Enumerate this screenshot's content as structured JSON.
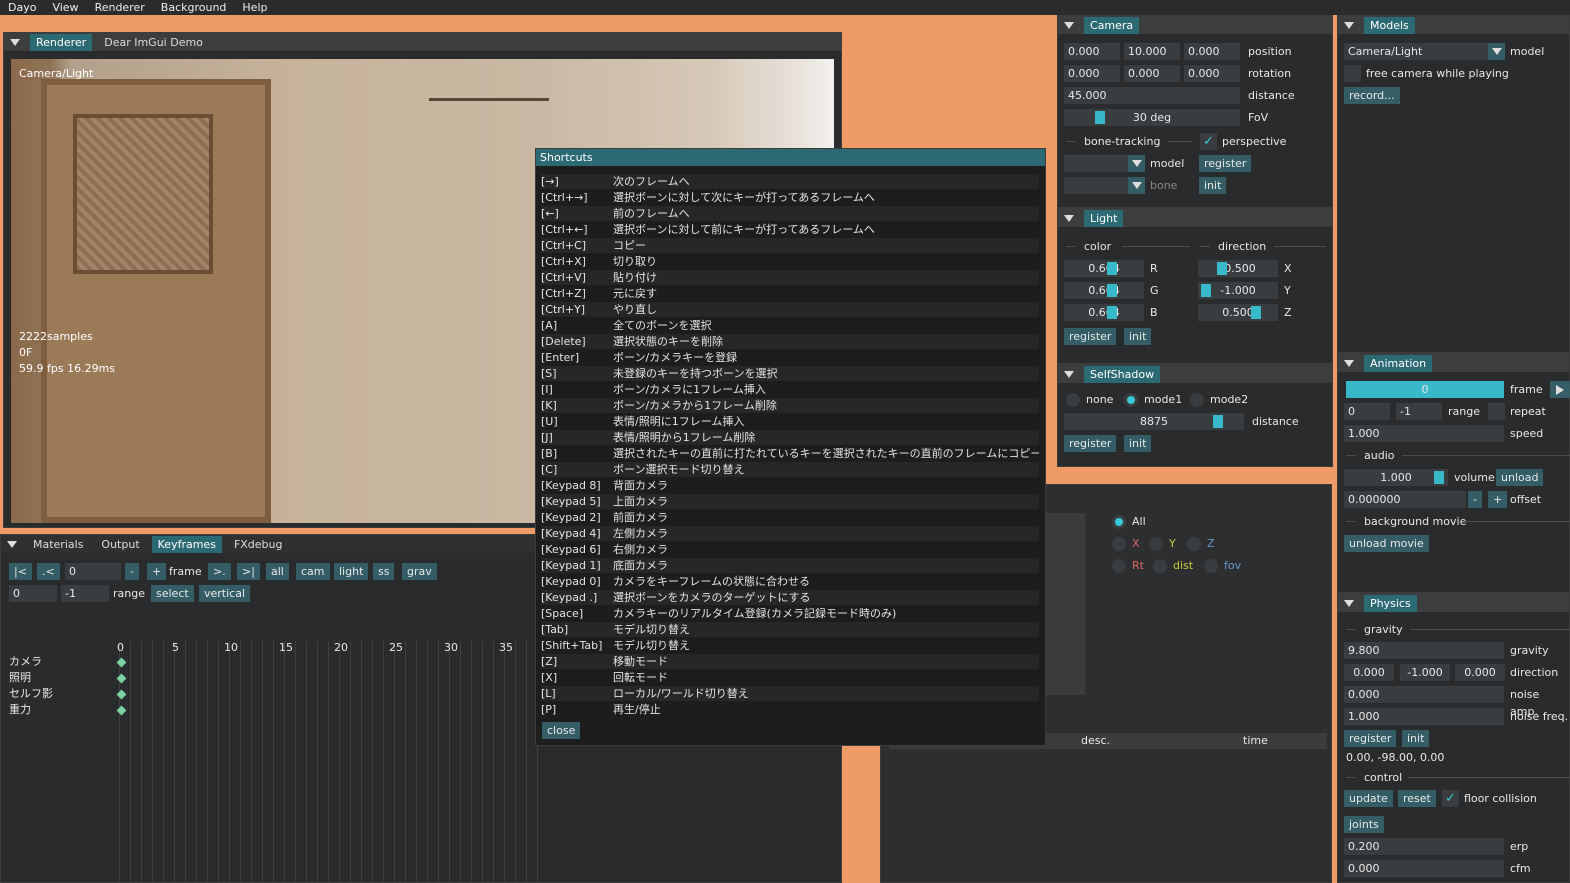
{
  "menu": [
    "Dayo",
    "View",
    "Renderer",
    "Background",
    "Help"
  ],
  "renderer_window": {
    "tabs": [
      "Renderer",
      "Dear ImGui Demo"
    ],
    "viewport_label": "Camera/Light",
    "stats": [
      "2222samples",
      "0F",
      "59.9 fps 16.29ms"
    ]
  },
  "bottom_window": {
    "tabs": [
      "Materials",
      "Output",
      "Keyframes",
      "FXdebug"
    ],
    "toolbar": {
      "first": "|<",
      "prev": ".<",
      "frame_value": "0",
      "minus": "-",
      "plus": "+",
      "frame_label": "frame",
      "next": ">.",
      "last": ">|",
      "all": "all",
      "cam": "cam",
      "light": "light",
      "ss": "ss",
      "grav": "grav"
    },
    "range": {
      "start": "0",
      "end": "-1",
      "label": "range",
      "select": "select",
      "vertical": "vertical"
    },
    "ticks": [
      "0",
      "5",
      "10",
      "15",
      "20",
      "25",
      "30",
      "35"
    ],
    "tracks": [
      "カメラ",
      "照明",
      "セルフ影",
      "重力"
    ]
  },
  "shortcuts": {
    "title": "Shortcuts",
    "rows": [
      {
        "key": "[→]",
        "desc": "次のフレームへ"
      },
      {
        "key": "[Ctrl+→]",
        "desc": "選択ボーンに対して次にキーが打ってあるフレームへ"
      },
      {
        "key": "[←]",
        "desc": "前のフレームへ"
      },
      {
        "key": "[Ctrl+←]",
        "desc": "選択ボーンに対して前にキーが打ってあるフレームへ"
      },
      {
        "key": "[Ctrl+C]",
        "desc": "コピー"
      },
      {
        "key": "[Ctrl+X]",
        "desc": "切り取り"
      },
      {
        "key": "[Ctrl+V]",
        "desc": "貼り付け"
      },
      {
        "key": "[Ctrl+Z]",
        "desc": "元に戻す"
      },
      {
        "key": "[Ctrl+Y]",
        "desc": "やり直し"
      },
      {
        "key": "[A]",
        "desc": "全てのボーンを選択"
      },
      {
        "key": "[Delete]",
        "desc": "選択状態のキーを削除"
      },
      {
        "key": "[Enter]",
        "desc": "ボーン/カメラキーを登録"
      },
      {
        "key": "[S]",
        "desc": "未登録のキーを持つボーンを選択"
      },
      {
        "key": "[I]",
        "desc": "ボーン/カメラに1フレーム挿入"
      },
      {
        "key": "[K]",
        "desc": "ボーン/カメラから1フレーム削除"
      },
      {
        "key": "[U]",
        "desc": "表情/照明に1フレーム挿入"
      },
      {
        "key": "[J]",
        "desc": "表情/照明から1フレーム削除"
      },
      {
        "key": "[B]",
        "desc": "選択されたキーの直前に打たれているキーを選択されたキーの直前のフレームにコピー"
      },
      {
        "key": "[C]",
        "desc": "ボーン選択モード切り替え"
      },
      {
        "key": "[Keypad 8]",
        "desc": "背面カメラ"
      },
      {
        "key": "[Keypad 5]",
        "desc": "上面カメラ"
      },
      {
        "key": "[Keypad 2]",
        "desc": "前面カメラ"
      },
      {
        "key": "[Keypad 4]",
        "desc": "左側カメラ"
      },
      {
        "key": "[Keypad 6]",
        "desc": "右側カメラ"
      },
      {
        "key": "[Keypad 1]",
        "desc": "底面カメラ"
      },
      {
        "key": "[Keypad 0]",
        "desc": "カメラをキーフレームの状態に合わせる"
      },
      {
        "key": "[Keypad .]",
        "desc": "選択ボーンをカメラのターゲットにする"
      },
      {
        "key": "[Space]",
        "desc": "カメラキーのリアルタイム登録(カメラ記録モード時のみ)"
      },
      {
        "key": "[Tab]",
        "desc": "モデル切り替え"
      },
      {
        "key": "[Shift+Tab]",
        "desc": "モデル切り替え"
      },
      {
        "key": "[Z]",
        "desc": "移動モード"
      },
      {
        "key": "[X]",
        "desc": "回転モード"
      },
      {
        "key": "[L]",
        "desc": "ローカル/ワールド切り替え"
      },
      {
        "key": "[P]",
        "desc": "再生/停止"
      }
    ],
    "close": "close"
  },
  "camera": {
    "title": "Camera",
    "position": [
      "0.000",
      "10.000",
      "0.000"
    ],
    "position_label": "position",
    "rotation": [
      "0.000",
      "0.000",
      "0.000"
    ],
    "rotation_label": "rotation",
    "distance": "45.000",
    "distance_label": "distance",
    "fov": "30 deg",
    "fov_label": "FoV",
    "bone_tracking": "bone-tracking",
    "perspective": "perspective",
    "model_label": "model",
    "bone_label": "bone",
    "register": "register",
    "init": "init"
  },
  "light": {
    "title": "Light",
    "color_label": "color",
    "direction_label": "direction",
    "rgb": [
      "0.604",
      "0.604",
      "0.604"
    ],
    "rgb_labels": [
      "R",
      "G",
      "B"
    ],
    "dir": [
      "-0.500",
      "-1.000",
      "0.500"
    ],
    "dir_labels": [
      "X",
      "Y",
      "Z"
    ],
    "register": "register",
    "init": "init"
  },
  "selfshadow": {
    "title": "SelfShadow",
    "modes": [
      "none",
      "mode1",
      "mode2"
    ],
    "selected": "mode1",
    "distance": "8875",
    "distance_label": "distance",
    "register": "register",
    "init": "init"
  },
  "curve": {
    "radios": [
      "All",
      "X",
      "Y",
      "Z",
      "Rt",
      "dist",
      "fov"
    ],
    "columns": [
      "desc.",
      "time"
    ]
  },
  "models": {
    "title": "Models",
    "selected": "Camera/Light",
    "model_label": "model",
    "free_camera": "free camera while playing",
    "record": "record..."
  },
  "animation": {
    "title": "Animation",
    "frame_value": "0",
    "frame_label": "frame",
    "range_start": "0",
    "range_end": "-1",
    "range_label": "range",
    "repeat_label": "repeat",
    "speed": "1.000",
    "speed_label": "speed",
    "audio_label": "audio",
    "volume": "1.000",
    "volume_label": "volume",
    "unload": "unload",
    "offset": "0.000000",
    "offset_minus": "-",
    "offset_plus": "+",
    "offset_label": "offset",
    "bg_movie_label": "background movie",
    "unload_movie": "unload movie"
  },
  "physics": {
    "title": "Physics",
    "gravity_section": "gravity",
    "gravity": "9.800",
    "gravity_label": "gravity",
    "direction": [
      "0.000",
      "-1.000",
      "0.000"
    ],
    "direction_label": "direction",
    "noise_amp": "0.000",
    "noise_amp_label": "noise amp.",
    "noise_freq": "1.000",
    "noise_freq_label": "noise freq.",
    "register": "register",
    "init": "init",
    "vector_text": "0.00, -98.00, 0.00",
    "control_label": "control",
    "update": "update",
    "reset": "reset",
    "floor_collision": "floor collision",
    "joints": "joints",
    "erp": "0.200",
    "erp_label": "erp",
    "cfm": "0.000",
    "cfm_label": "cfm"
  }
}
